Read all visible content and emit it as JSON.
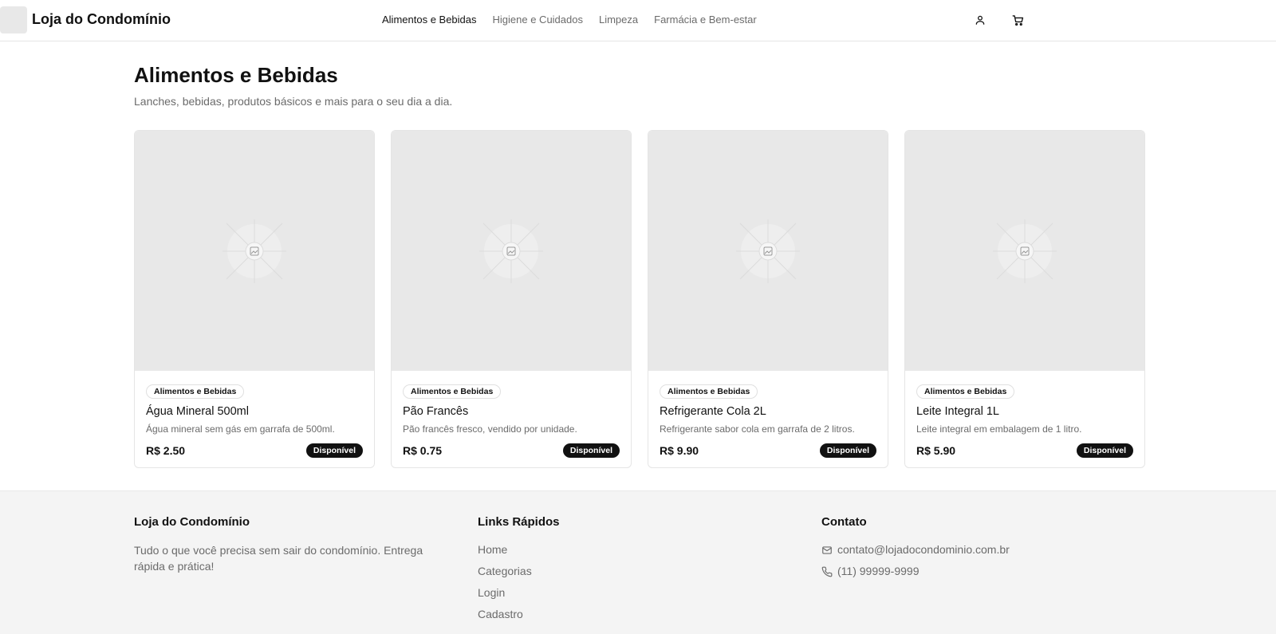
{
  "header": {
    "brand": "Loja do Condomínio",
    "nav": [
      {
        "label": "Alimentos e Bebidas",
        "active": true
      },
      {
        "label": "Higiene e Cuidados",
        "active": false
      },
      {
        "label": "Limpeza",
        "active": false
      },
      {
        "label": "Farmácia e Bem-estar",
        "active": false
      }
    ],
    "icons": [
      "user-icon",
      "cart-icon"
    ]
  },
  "main": {
    "title": "Alimentos e Bebidas",
    "subtitle": "Lanches, bebidas, produtos básicos e mais para o seu dia a dia.",
    "products": [
      {
        "category": "Alimentos e Bebidas",
        "name": "Água Mineral 500ml",
        "description": "Água mineral sem gás em garrafa de 500ml.",
        "price": "R$ 2.50",
        "status": "Disponível"
      },
      {
        "category": "Alimentos e Bebidas",
        "name": "Pão Francês",
        "description": "Pão francês fresco, vendido por unidade.",
        "price": "R$ 0.75",
        "status": "Disponível"
      },
      {
        "category": "Alimentos e Bebidas",
        "name": "Refrigerante Cola 2L",
        "description": "Refrigerante sabor cola em garrafa de 2 litros.",
        "price": "R$ 9.90",
        "status": "Disponível"
      },
      {
        "category": "Alimentos e Bebidas",
        "name": "Leite Integral 1L",
        "description": "Leite integral em embalagem de 1 litro.",
        "price": "R$ 5.90",
        "status": "Disponível"
      }
    ]
  },
  "footer": {
    "about": {
      "title": "Loja do Condomínio",
      "text": "Tudo o que você precisa sem sair do condomínio. Entrega rápida e prática!"
    },
    "links": {
      "title": "Links Rápidos",
      "items": [
        "Home",
        "Categorias",
        "Login",
        "Cadastro"
      ]
    },
    "contact": {
      "title": "Contato",
      "email": "contato@lojadocondominio.com.br",
      "phone": "(11) 99999-9999"
    }
  },
  "colors": {
    "text": "#111111",
    "muted": "#6b6b6b",
    "placeholder": "#e8e8e8",
    "badge": "#111111",
    "footer_bg": "#f4f4f4"
  }
}
